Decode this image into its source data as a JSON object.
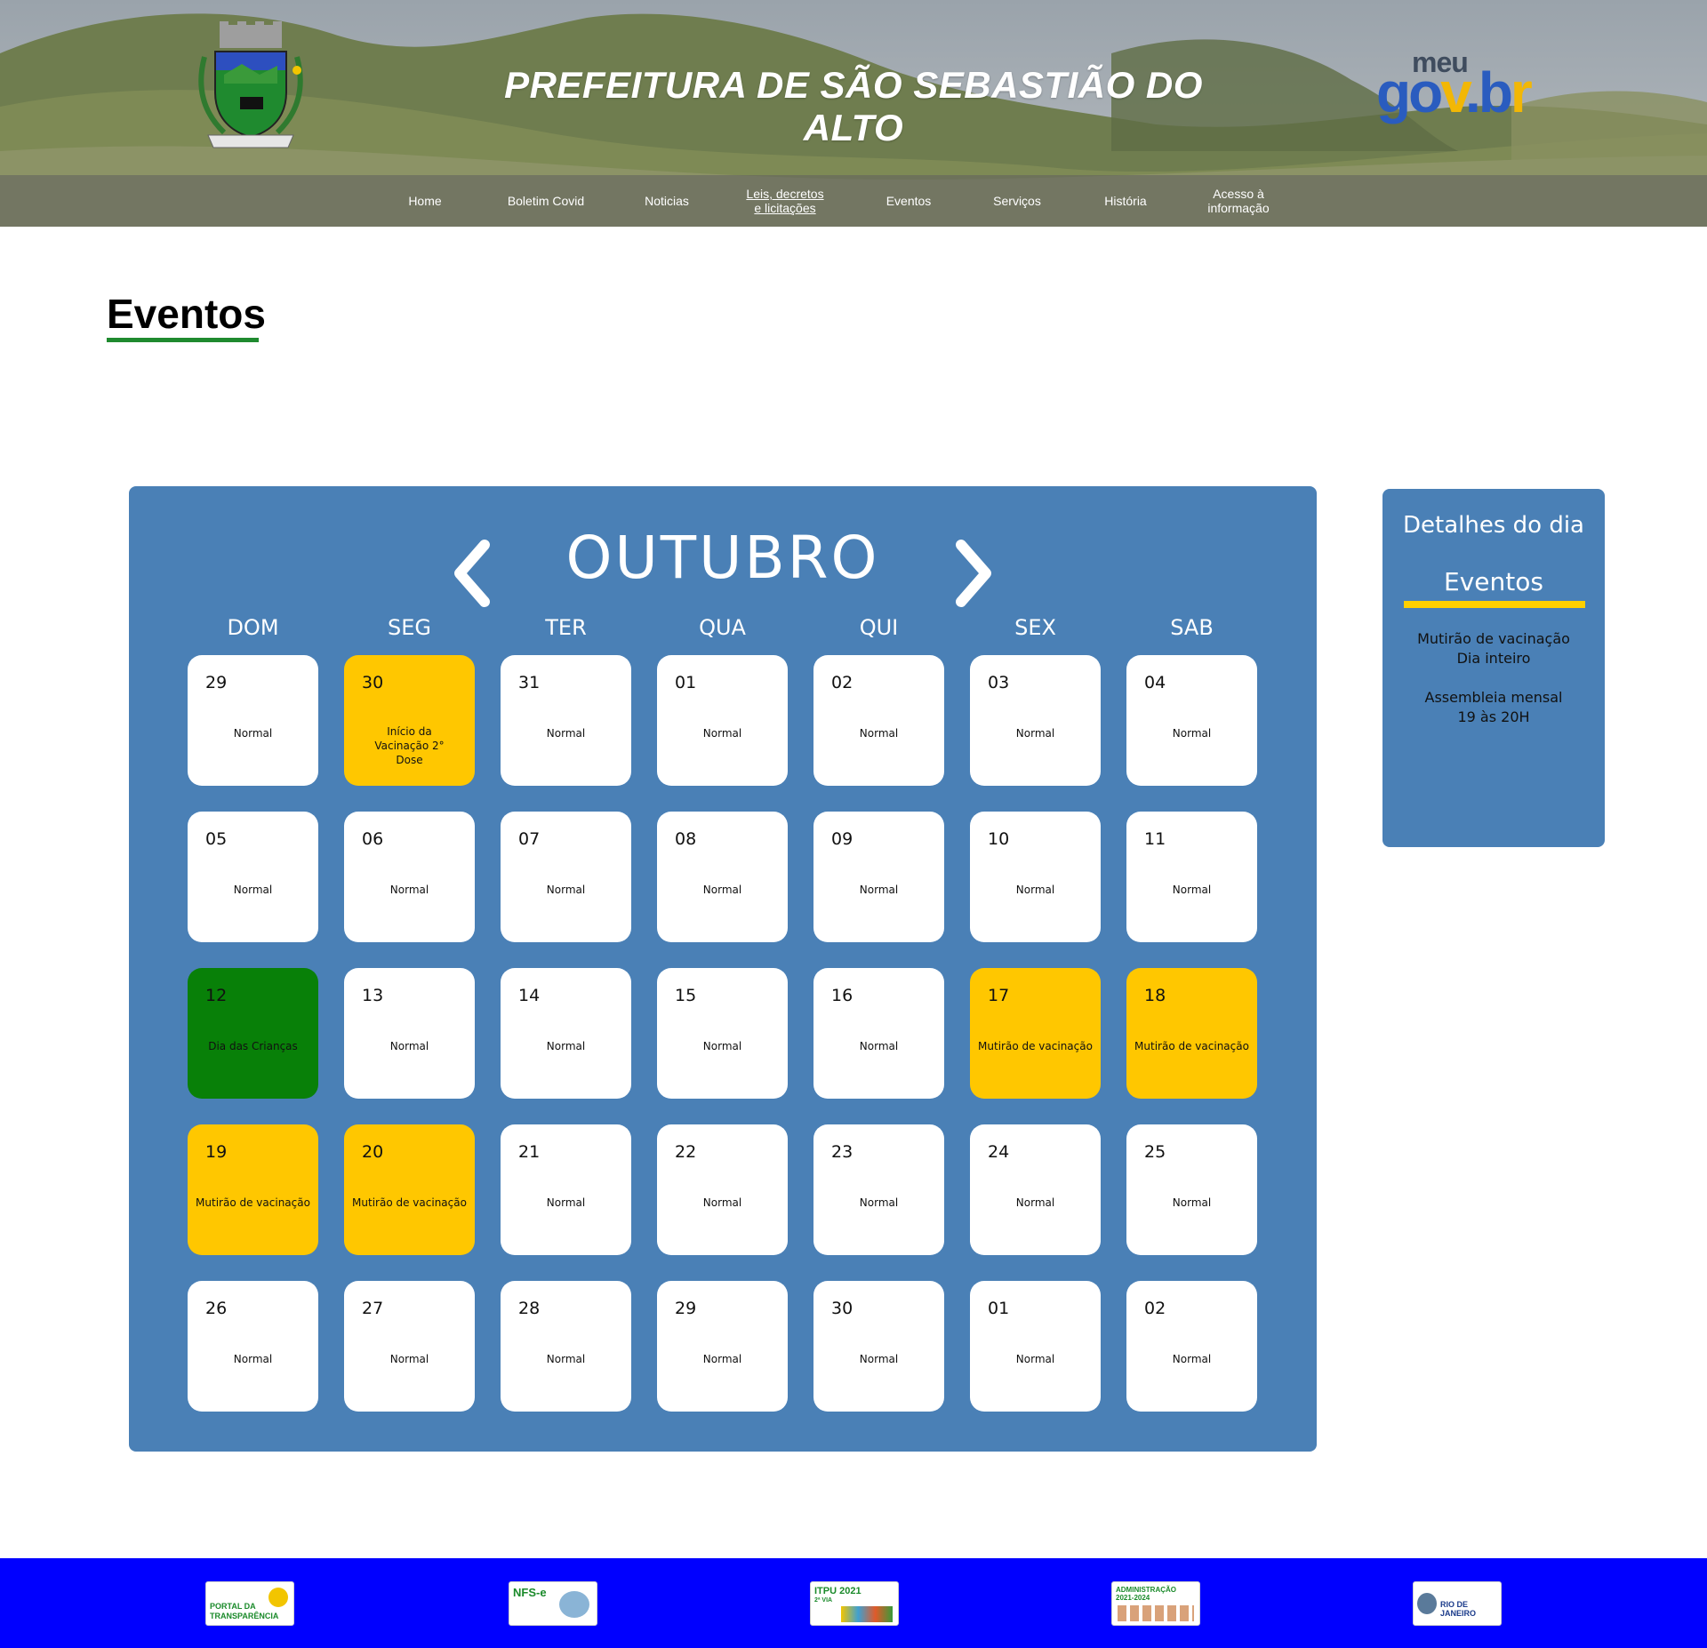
{
  "header": {
    "title": "PREFEITURA DE SÃO SEBASTIÃO DO ALTO",
    "govbr_top": "meu",
    "govbr_main": [
      "g",
      "o",
      "v",
      ".",
      "b",
      "r"
    ],
    "govbr_colors": [
      "#2a5cbf",
      "#2a5cbf",
      "#f2b705",
      "#2a5cbf",
      "#2a5cbf",
      "#f2b705"
    ],
    "crest_icon": "municipal-coat-of-arms"
  },
  "nav": [
    {
      "label": "Home"
    },
    {
      "label": "Boletim Covid"
    },
    {
      "label": "Noticias"
    },
    {
      "label_lines": [
        "Leis, decretos",
        "e licitações"
      ]
    },
    {
      "label": "Eventos"
    },
    {
      "label": "Serviços"
    },
    {
      "label": "História"
    },
    {
      "label_lines": [
        "Acesso à",
        "informação"
      ]
    }
  ],
  "page": {
    "title": "Eventos"
  },
  "calendar": {
    "month": "OUTUBRO",
    "prev_icon": "chevron-left-icon",
    "next_icon": "chevron-right-icon",
    "weekdays": [
      "DOM",
      "SEG",
      "TER",
      "QUA",
      "QUI",
      "SEX",
      "SAB"
    ],
    "colors": {
      "panel": "#4a80b6",
      "normal": "#ffffff",
      "event": "#ffc700",
      "holiday": "#088008"
    },
    "weeks": [
      [
        {
          "num": "29",
          "label": "Normal",
          "type": "normal"
        },
        {
          "num": "30",
          "label": "Início da Vacinação 2° Dose",
          "type": "event"
        },
        {
          "num": "31",
          "label": "Normal",
          "type": "normal"
        },
        {
          "num": "01",
          "label": "Normal",
          "type": "normal"
        },
        {
          "num": "02",
          "label": "Normal",
          "type": "normal"
        },
        {
          "num": "03",
          "label": "Normal",
          "type": "normal"
        },
        {
          "num": "04",
          "label": "Normal",
          "type": "normal"
        }
      ],
      [
        {
          "num": "05",
          "label": "Normal",
          "type": "normal"
        },
        {
          "num": "06",
          "label": "Normal",
          "type": "normal"
        },
        {
          "num": "07",
          "label": "Normal",
          "type": "normal"
        },
        {
          "num": "08",
          "label": "Normal",
          "type": "normal"
        },
        {
          "num": "09",
          "label": "Normal",
          "type": "normal"
        },
        {
          "num": "10",
          "label": "Normal",
          "type": "normal"
        },
        {
          "num": "11",
          "label": "Normal",
          "type": "normal"
        }
      ],
      [
        {
          "num": "12",
          "label": "Dia das Crianças",
          "type": "holiday"
        },
        {
          "num": "13",
          "label": "Normal",
          "type": "normal"
        },
        {
          "num": "14",
          "label": "Normal",
          "type": "normal"
        },
        {
          "num": "15",
          "label": "Normal",
          "type": "normal"
        },
        {
          "num": "16",
          "label": "Normal",
          "type": "normal"
        },
        {
          "num": "17",
          "label": "Mutirão de vacinação",
          "type": "event"
        },
        {
          "num": "18",
          "label": "Mutirão de vacinação",
          "type": "event"
        }
      ],
      [
        {
          "num": "19",
          "label": "Mutirão de vacinação",
          "type": "event"
        },
        {
          "num": "20",
          "label": "Mutirão de vacinação",
          "type": "event"
        },
        {
          "num": "21",
          "label": "Normal",
          "type": "normal"
        },
        {
          "num": "22",
          "label": "Normal",
          "type": "normal"
        },
        {
          "num": "23",
          "label": "Normal",
          "type": "normal"
        },
        {
          "num": "24",
          "label": "Normal",
          "type": "normal"
        },
        {
          "num": "25",
          "label": "Normal",
          "type": "normal"
        }
      ],
      [
        {
          "num": "26",
          "label": "Normal",
          "type": "normal"
        },
        {
          "num": "27",
          "label": "Normal",
          "type": "normal"
        },
        {
          "num": "28",
          "label": "Normal",
          "type": "normal"
        },
        {
          "num": "29",
          "label": "Normal",
          "type": "normal"
        },
        {
          "num": "30",
          "label": "Normal",
          "type": "normal"
        },
        {
          "num": "01",
          "label": "Normal",
          "type": "normal"
        },
        {
          "num": "02",
          "label": "Normal",
          "type": "normal"
        }
      ]
    ]
  },
  "details": {
    "title": "Detalhes do dia",
    "subtitle": "Eventos",
    "events": [
      {
        "name": "Mutirão de vacinação",
        "time": "Dia inteiro"
      },
      {
        "name": "Assembleia mensal",
        "time": "19 às 20H"
      }
    ]
  },
  "footer": {
    "background": "#0000ff",
    "logos": [
      {
        "name": "portal-transparencia-logo",
        "lines": [
          "PORTAL DA",
          "TRANSPARÊNCIA"
        ]
      },
      {
        "name": "nfse-logo",
        "lines": [
          "NFS-e"
        ]
      },
      {
        "name": "itpu-logo",
        "lines": [
          "ITPU 2021",
          "2ª VIA"
        ]
      },
      {
        "name": "administracao-logo",
        "lines": [
          "ADMINISTRAÇÃO",
          "2021-2024"
        ]
      },
      {
        "name": "rio-de-janeiro-logo",
        "lines": [
          "RIO DE JANEIRO"
        ]
      }
    ]
  }
}
